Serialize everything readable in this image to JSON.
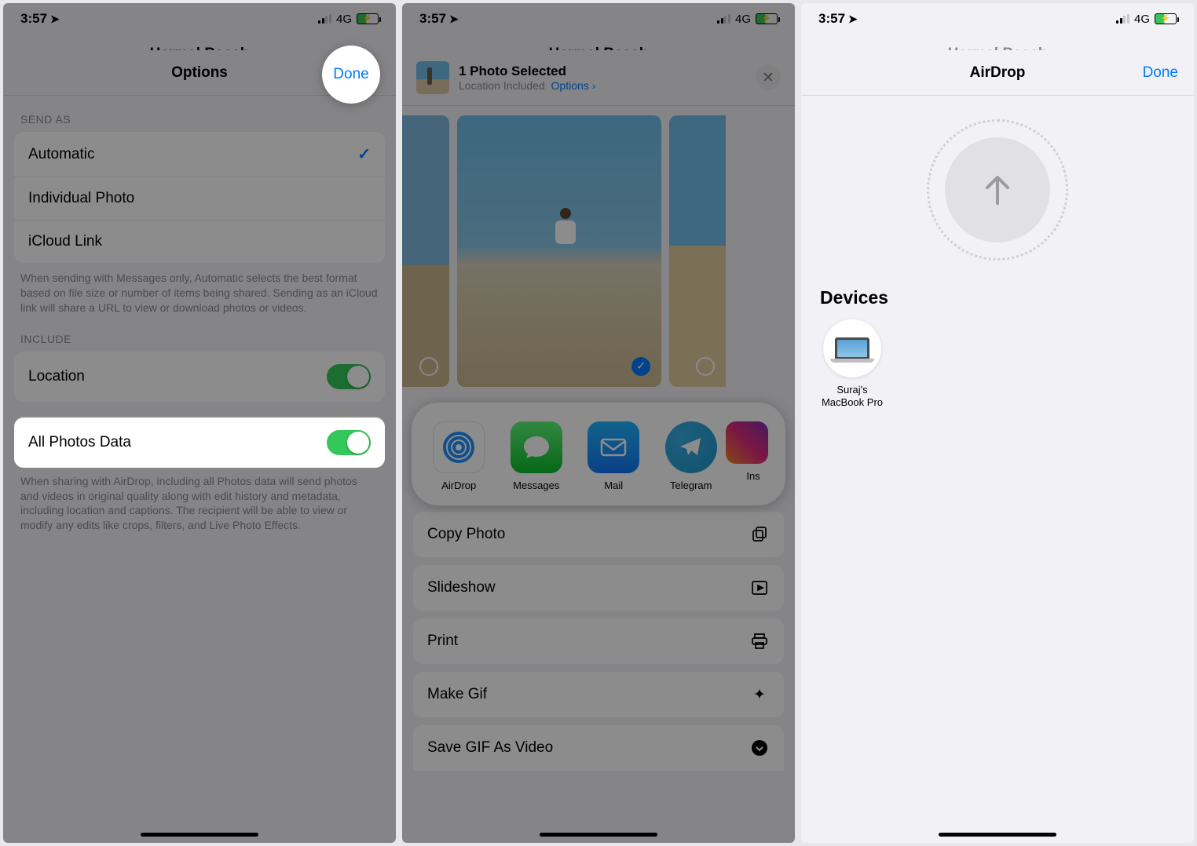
{
  "status": {
    "time": "3:57",
    "network": "4G"
  },
  "background_title": "Harmal Beach",
  "panel1": {
    "sheet_title": "Options",
    "done": "Done",
    "send_as_label": "SEND AS",
    "options": [
      {
        "label": "Automatic",
        "checked": true
      },
      {
        "label": "Individual Photo",
        "checked": false
      },
      {
        "label": "iCloud Link",
        "checked": false
      }
    ],
    "send_as_footer": "When sending with Messages only, Automatic selects the best format based on file size or number of items being shared. Sending as an iCloud link will share a URL to view or download photos or videos.",
    "include_label": "INCLUDE",
    "location_label": "Location",
    "location_on": true,
    "all_photos_label": "All Photos Data",
    "all_photos_on": true,
    "all_photos_footer": "When sharing with AirDrop, including all Photos data will send photos and videos in original quality along with edit history and metadata, including location and captions. The recipient will be able to view or modify any edits like crops, filters, and Live Photo Effects."
  },
  "panel2": {
    "header_title": "1 Photo Selected",
    "header_sub_prefix": "Location Included",
    "header_sub_options": "Options",
    "apps": [
      {
        "label": "AirDrop"
      },
      {
        "label": "Messages"
      },
      {
        "label": "Mail"
      },
      {
        "label": "Telegram"
      }
    ],
    "peek_label": "Ins",
    "actions": [
      {
        "label": "Copy Photo",
        "icon": "copy"
      },
      {
        "label": "Slideshow",
        "icon": "play"
      },
      {
        "label": "Print",
        "icon": "print"
      },
      {
        "label": "Make Gif",
        "icon": "sparkle"
      },
      {
        "label": "Save GIF As Video",
        "icon": "circle"
      }
    ]
  },
  "panel3": {
    "sheet_title": "AirDrop",
    "done": "Done",
    "devices_label": "Devices",
    "device_name": "Suraj's MacBook Pro"
  }
}
